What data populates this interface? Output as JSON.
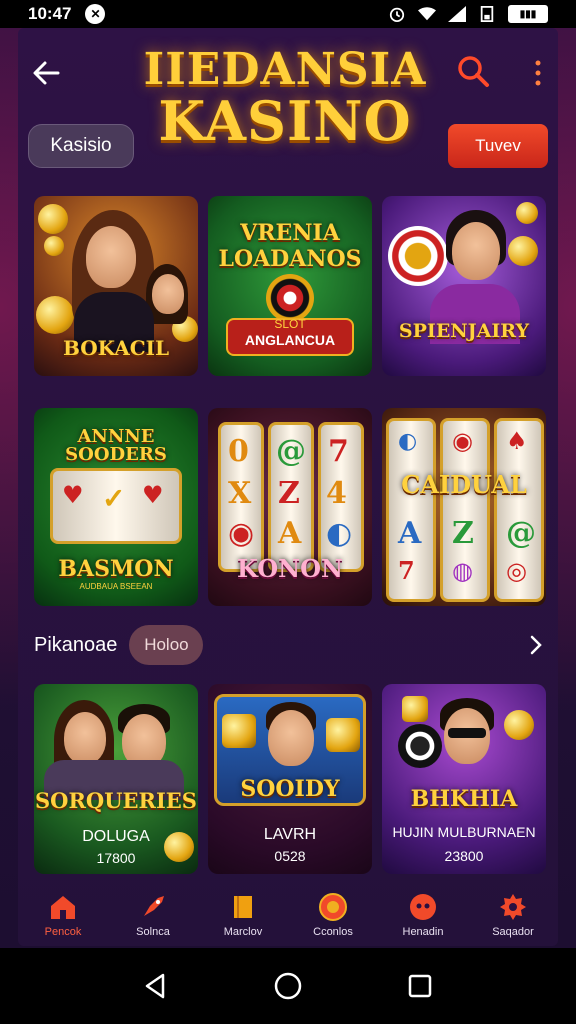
{
  "status": {
    "time": "10:47"
  },
  "header": {
    "logo_line1": "IIEDANSIA",
    "logo_line2": "KASINO",
    "left_pill": "Kasisio",
    "right_button": "Tuvev"
  },
  "row1": [
    {
      "title": "BOKACIL"
    },
    {
      "title_top": "VRENIA",
      "title_mid": "LOADANOS",
      "badge_top": "SLOT",
      "badge": "ANGLANCUA"
    },
    {
      "title": "SPIENJAIRY"
    }
  ],
  "row2": [
    {
      "title_top": "ANNNE",
      "title_mid": "SOODERS",
      "title": "BASMON",
      "sub": "AUDBAUA BSEEAN"
    },
    {
      "title": "KONON"
    },
    {
      "title": "CAIDUAL"
    }
  ],
  "section": {
    "label": "Pikanoae",
    "chip": "Holoo"
  },
  "row3": [
    {
      "title": "SORQUERIES",
      "sub": "DOLUGA",
      "value": "17800"
    },
    {
      "title": "SOOIDY",
      "sub": "LAVRH",
      "value": "0528"
    },
    {
      "title": "BHKHIA",
      "sub": "HUJIN MULBURNAEN",
      "value": "23800"
    }
  ],
  "nav": [
    {
      "label": "Pencok",
      "icon": "home-icon"
    },
    {
      "label": "Solnca",
      "icon": "rocket-icon"
    },
    {
      "label": "Marclov",
      "icon": "ticket-icon"
    },
    {
      "label": "Cconlos",
      "icon": "chip-icon"
    },
    {
      "label": "Henadin",
      "icon": "bag-icon"
    },
    {
      "label": "Saqador",
      "icon": "gear-icon"
    }
  ],
  "colors": {
    "accent": "#f14a2a",
    "gold": "#ffcf3a",
    "bg": "#24113a"
  }
}
